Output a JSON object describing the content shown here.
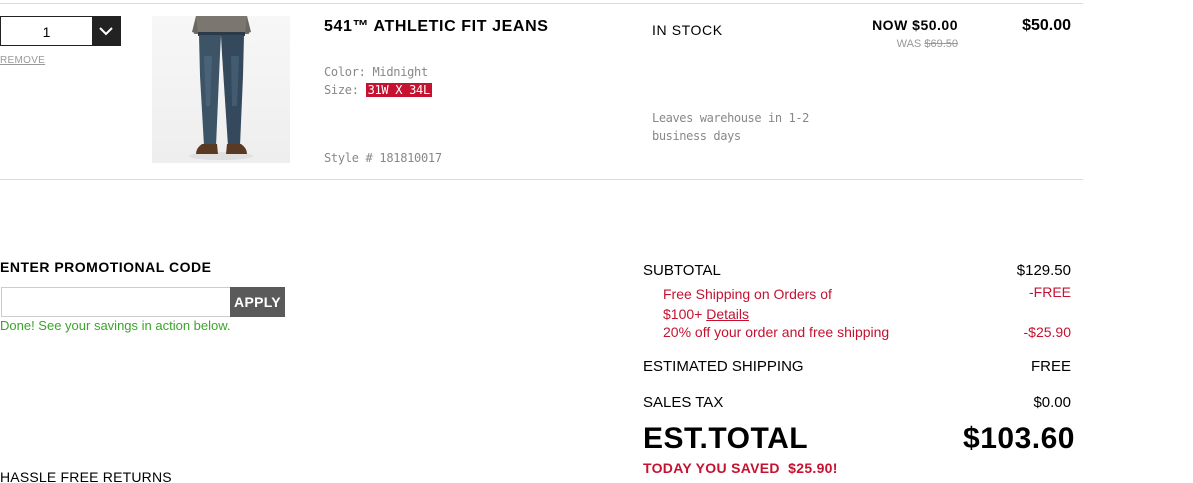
{
  "cart_item": {
    "quantity": "1",
    "remove_label": "REMOVE",
    "name": "541™ ATHLETIC FIT JEANS",
    "color_label": "Color:",
    "color_value": "Midnight",
    "size_label": "Size:",
    "size_value": "31W X 34L",
    "style_label": "Style #",
    "style_value": "181810017",
    "stock_status": "IN STOCK",
    "ship_note": "Leaves warehouse in 1-2 business days",
    "now_price": "NOW $50.00",
    "was_prefix": "WAS",
    "was_price": "$69.50",
    "line_total": "$50.00"
  },
  "promo": {
    "title": "ENTER PROMOTIONAL CODE",
    "input_value": "",
    "apply_label": "APPLY",
    "success_msg": "Done! See your savings in action below."
  },
  "footer": {
    "hassle_label": "HASSLE FREE RETURNS"
  },
  "summary": {
    "subtotal_label": "SUBTOTAL",
    "subtotal_value": "$129.50",
    "discount1_label": "Free Shipping on Orders of $100+",
    "discount1_link": "Details",
    "discount1_value": "-FREE",
    "discount2_label": "20% off your order and free shipping",
    "discount2_value": "-$25.90",
    "shipping_label": "ESTIMATED SHIPPING",
    "shipping_value": "FREE",
    "tax_label": "SALES TAX",
    "tax_value": "$0.00",
    "total_label": "EST.TOTAL",
    "total_value": "$103.60",
    "saved_text": "TODAY YOU SAVED  $25.90!"
  },
  "colors": {
    "accent_red": "#c41230",
    "success_green": "#3aa52a",
    "apply_gray": "#5a5a5a"
  }
}
